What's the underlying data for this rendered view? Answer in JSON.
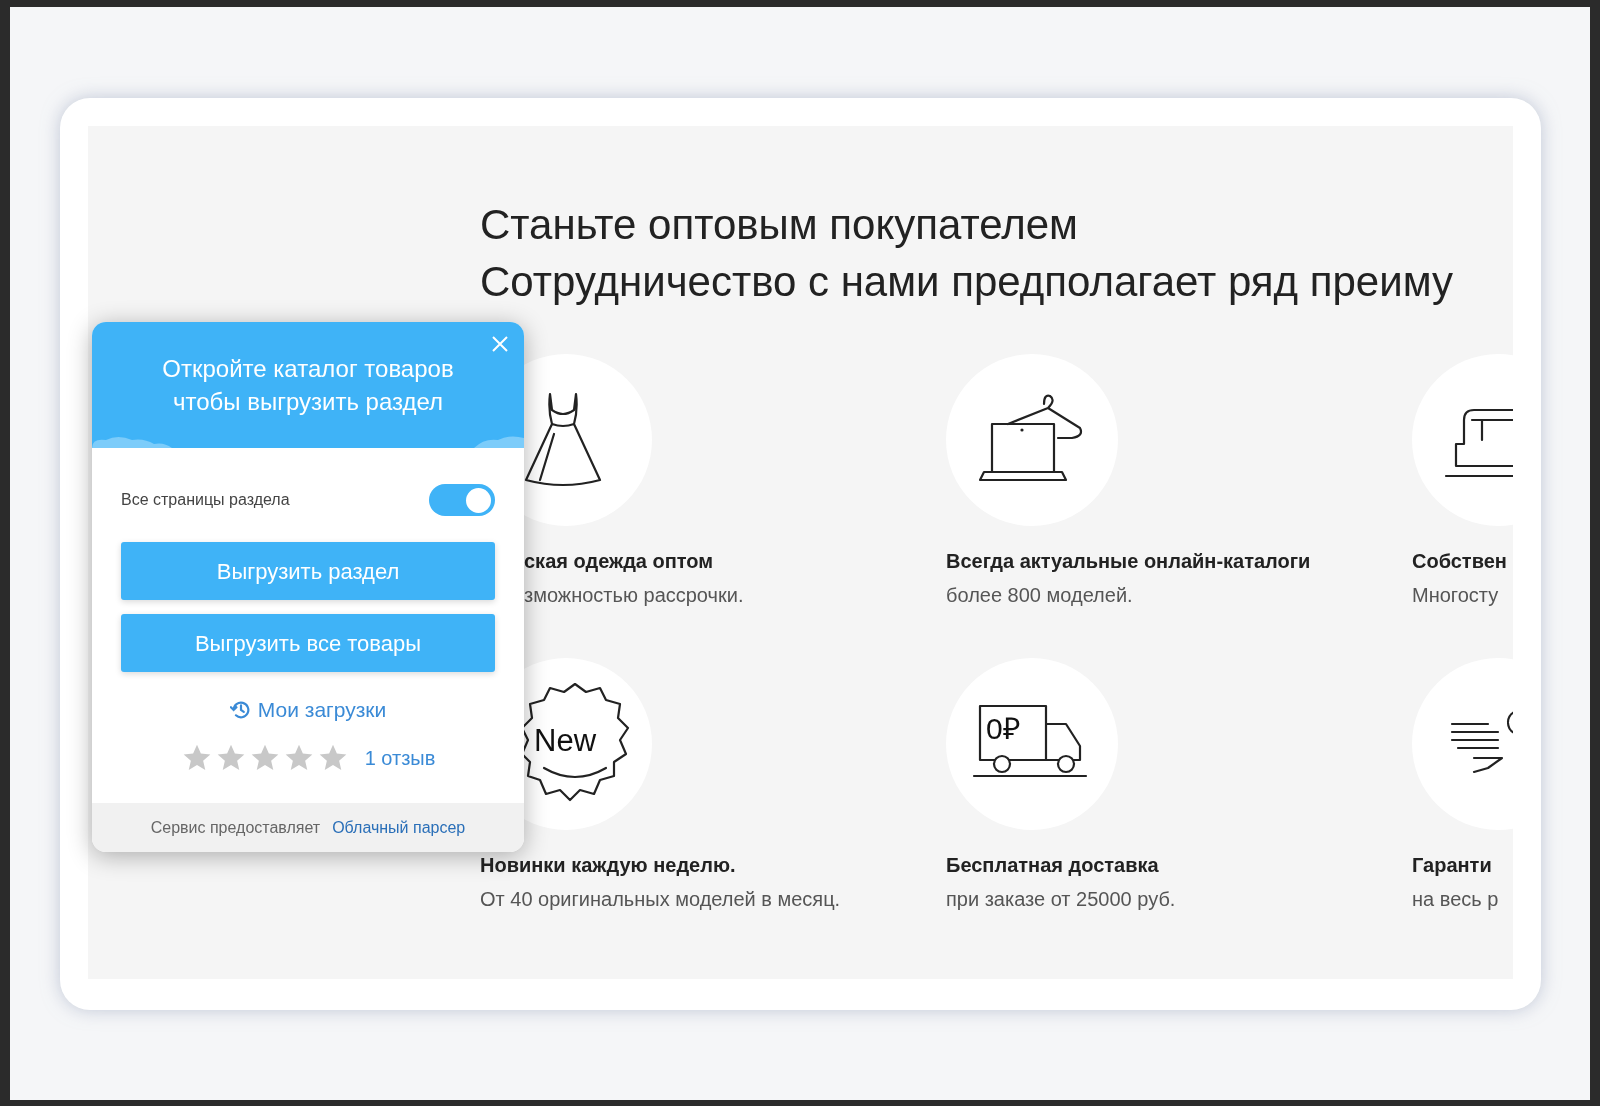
{
  "heading": {
    "lines": [
      "Станьте оптовым покупателем",
      "Сотрудничество с нами предполагает ряд преиму"
    ]
  },
  "features": [
    {
      "kind": "dress",
      "title": "ская одежда оптом",
      "subtitle": "зможностью рассрочки."
    },
    {
      "kind": "laptop",
      "title": "Всегда актуальные онлайн-каталоги",
      "subtitle": "более 800 моделей."
    },
    {
      "kind": "sewing",
      "title": "Собствен",
      "subtitle": "Многосту"
    },
    {
      "kind": "new",
      "badge_text": "New",
      "title": "Новинки каждую неделю.",
      "subtitle": "От 40 оригинальных моделей в месяц."
    },
    {
      "kind": "truck",
      "badge_text": "0₽",
      "title": "Бесплатная доставка",
      "subtitle": "при заказе от 25000 руб."
    },
    {
      "kind": "hand",
      "title": "Гаранти",
      "subtitle": "на весь р"
    }
  ],
  "popup": {
    "title": "Откройте каталог товаров чтобы выгрузить раздел",
    "toggle": {
      "label": "Все страницы раздела",
      "on": true
    },
    "buttons": [
      "Выгрузить раздел",
      "Выгрузить все товары"
    ],
    "downloads_link": "Мои загрузки",
    "rating": {
      "stars": 0,
      "reviews": "1 отзыв"
    },
    "footer": {
      "text": "Сервис предоставляет",
      "link": "Облачный парсер"
    }
  }
}
